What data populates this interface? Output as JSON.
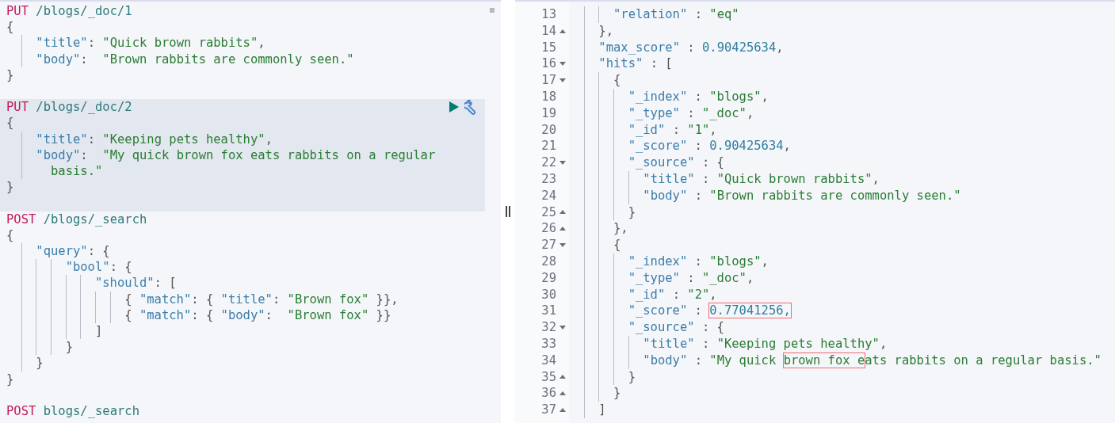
{
  "editor": {
    "requests": [
      {
        "method": "PUT",
        "path": "/blogs/_doc/1",
        "selected": false,
        "body": [
          {
            "tokens": [
              {
                "kind": "punct",
                "text": "{"
              }
            ],
            "children": [
              {
                "tokens": [
                  {
                    "kind": "key",
                    "text": "\"title\""
                  },
                  {
                    "kind": "punct",
                    "text": ": "
                  },
                  {
                    "kind": "string",
                    "text": "\"Quick brown rabbits\""
                  },
                  {
                    "kind": "punct",
                    "text": ","
                  }
                ]
              },
              {
                "tokens": [
                  {
                    "kind": "key",
                    "text": "\"body\""
                  },
                  {
                    "kind": "punct",
                    "text": ":  "
                  },
                  {
                    "kind": "string",
                    "text": "\"Brown rabbits are commonly seen.\""
                  }
                ]
              }
            ]
          },
          {
            "tokens": [
              {
                "kind": "punct",
                "text": "}"
              }
            ]
          }
        ]
      },
      {
        "method": "PUT",
        "path": "/blogs/_doc/2",
        "selected": true,
        "body": [
          {
            "tokens": [
              {
                "kind": "punct",
                "text": "{"
              }
            ],
            "children": [
              {
                "tokens": [
                  {
                    "kind": "key",
                    "text": "\"title\""
                  },
                  {
                    "kind": "punct",
                    "text": ": "
                  },
                  {
                    "kind": "string",
                    "text": "\"Keeping pets healthy\""
                  },
                  {
                    "kind": "punct",
                    "text": ","
                  }
                ]
              },
              {
                "tokens": [
                  {
                    "kind": "key",
                    "text": "\"body\""
                  },
                  {
                    "kind": "punct",
                    "text": ":  "
                  },
                  {
                    "kind": "string",
                    "text": "\"My quick brown fox eats rabbits on a regular basis.\""
                  }
                ]
              }
            ]
          },
          {
            "tokens": [
              {
                "kind": "punct",
                "text": "}"
              }
            ]
          }
        ]
      },
      {
        "method": "POST",
        "path": "/blogs/_search",
        "selected": false,
        "body": [
          {
            "tokens": [
              {
                "kind": "punct",
                "text": "{"
              }
            ],
            "children": [
              {
                "tokens": [
                  {
                    "kind": "key",
                    "text": "\"query\""
                  },
                  {
                    "kind": "punct",
                    "text": ": {"
                  }
                ],
                "children": [
                  {
                    "tokens": [
                      {
                        "kind": "key",
                        "text": "\"bool\""
                      },
                      {
                        "kind": "punct",
                        "text": ": {"
                      }
                    ],
                    "children": [
                      {
                        "tokens": [
                          {
                            "kind": "key",
                            "text": "\"should\""
                          },
                          {
                            "kind": "punct",
                            "text": ": ["
                          }
                        ],
                        "children": [
                          {
                            "tokens": [
                              {
                                "kind": "punct",
                                "text": "{ "
                              },
                              {
                                "kind": "key",
                                "text": "\"match\""
                              },
                              {
                                "kind": "punct",
                                "text": ": { "
                              },
                              {
                                "kind": "key",
                                "text": "\"title\""
                              },
                              {
                                "kind": "punct",
                                "text": ": "
                              },
                              {
                                "kind": "string",
                                "text": "\"Brown fox\""
                              },
                              {
                                "kind": "punct",
                                "text": " }},"
                              }
                            ]
                          },
                          {
                            "tokens": [
                              {
                                "kind": "punct",
                                "text": "{ "
                              },
                              {
                                "kind": "key",
                                "text": "\"match\""
                              },
                              {
                                "kind": "punct",
                                "text": ": { "
                              },
                              {
                                "kind": "key",
                                "text": "\"body\""
                              },
                              {
                                "kind": "punct",
                                "text": ":  "
                              },
                              {
                                "kind": "string",
                                "text": "\"Brown fox\""
                              },
                              {
                                "kind": "punct",
                                "text": " }}"
                              }
                            ]
                          }
                        ]
                      },
                      {
                        "tokens": [
                          {
                            "kind": "punct",
                            "text": "]"
                          }
                        ]
                      }
                    ]
                  },
                  {
                    "tokens": [
                      {
                        "kind": "punct",
                        "text": "}"
                      }
                    ]
                  }
                ]
              },
              {
                "tokens": [
                  {
                    "kind": "punct",
                    "text": "}"
                  }
                ]
              }
            ]
          },
          {
            "tokens": [
              {
                "kind": "punct",
                "text": "}"
              }
            ]
          }
        ]
      },
      {
        "method": "POST",
        "path": "blogs/_search",
        "selected": false
      }
    ]
  },
  "output": {
    "lines": [
      {
        "children": [
          {
            "children": [
              {
                "children": [
                  {
                    "number": "13",
                    "closes_block": false,
                    "tokens": [
                      {
                        "kind": "key",
                        "text": "\"relation\""
                      },
                      {
                        "kind": "punct",
                        "text": " : "
                      },
                      {
                        "kind": "string",
                        "text": "\"eq\""
                      }
                    ]
                  }
                ]
              },
              {
                "number": "14",
                "closes_block": true,
                "tokens": [
                  {
                    "kind": "punct",
                    "text": "},"
                  }
                ]
              },
              {
                "number": "15",
                "closes_block": false,
                "tokens": [
                  {
                    "kind": "key",
                    "text": "\"max_score\""
                  },
                  {
                    "kind": "punct",
                    "text": " : "
                  },
                  {
                    "kind": "number",
                    "text": "0.90425634"
                  },
                  {
                    "kind": "punct",
                    "text": ","
                  }
                ]
              },
              {
                "number": "16",
                "closes_block": false,
                "tokens": [
                  {
                    "kind": "key",
                    "text": "\"hits\""
                  },
                  {
                    "kind": "punct",
                    "text": " : ["
                  }
                ],
                "children": [
                  {
                    "number": "17",
                    "closes_block": false,
                    "tokens": [
                      {
                        "kind": "punct",
                        "text": "{"
                      }
                    ],
                    "children": [
                      {
                        "number": "18",
                        "closes_block": false,
                        "tokens": [
                          {
                            "kind": "key",
                            "text": "\"_index\""
                          },
                          {
                            "kind": "punct",
                            "text": " : "
                          },
                          {
                            "kind": "string",
                            "text": "\"blogs\""
                          },
                          {
                            "kind": "punct",
                            "text": ","
                          }
                        ]
                      },
                      {
                        "number": "19",
                        "closes_block": false,
                        "tokens": [
                          {
                            "kind": "key",
                            "text": "\"_type\""
                          },
                          {
                            "kind": "punct",
                            "text": " : "
                          },
                          {
                            "kind": "string",
                            "text": "\"_doc\""
                          },
                          {
                            "kind": "punct",
                            "text": ","
                          }
                        ]
                      },
                      {
                        "number": "20",
                        "closes_block": false,
                        "tokens": [
                          {
                            "kind": "key",
                            "text": "\"_id\""
                          },
                          {
                            "kind": "punct",
                            "text": " : "
                          },
                          {
                            "kind": "string",
                            "text": "\"1\""
                          },
                          {
                            "kind": "punct",
                            "text": ","
                          }
                        ]
                      },
                      {
                        "number": "21",
                        "closes_block": false,
                        "tokens": [
                          {
                            "kind": "key",
                            "text": "\"_score\""
                          },
                          {
                            "kind": "punct",
                            "text": " : "
                          },
                          {
                            "kind": "number",
                            "text": "0.90425634"
                          },
                          {
                            "kind": "punct",
                            "text": ","
                          }
                        ]
                      },
                      {
                        "number": "22",
                        "closes_block": false,
                        "tokens": [
                          {
                            "kind": "key",
                            "text": "\"_source\""
                          },
                          {
                            "kind": "punct",
                            "text": " : {"
                          }
                        ],
                        "children": [
                          {
                            "number": "23",
                            "closes_block": false,
                            "tokens": [
                              {
                                "kind": "key",
                                "text": "\"title\""
                              },
                              {
                                "kind": "punct",
                                "text": " : "
                              },
                              {
                                "kind": "string",
                                "text": "\"Quick brown rabbits\""
                              },
                              {
                                "kind": "punct",
                                "text": ","
                              }
                            ]
                          },
                          {
                            "number": "24",
                            "closes_block": false,
                            "tokens": [
                              {
                                "kind": "key",
                                "text": "\"body\""
                              },
                              {
                                "kind": "punct",
                                "text": " : "
                              },
                              {
                                "kind": "string",
                                "text": "\"Brown rabbits are commonly seen.\""
                              }
                            ]
                          }
                        ]
                      },
                      {
                        "number": "25",
                        "closes_block": true,
                        "tokens": [
                          {
                            "kind": "punct",
                            "text": "}"
                          }
                        ]
                      }
                    ]
                  },
                  {
                    "number": "26",
                    "closes_block": true,
                    "tokens": [
                      {
                        "kind": "punct",
                        "text": "},"
                      }
                    ]
                  },
                  {
                    "number": "27",
                    "closes_block": false,
                    "tokens": [
                      {
                        "kind": "punct",
                        "text": "{"
                      }
                    ],
                    "children": [
                      {
                        "number": "28",
                        "closes_block": false,
                        "tokens": [
                          {
                            "kind": "key",
                            "text": "\"_index\""
                          },
                          {
                            "kind": "punct",
                            "text": " : "
                          },
                          {
                            "kind": "string",
                            "text": "\"blogs\""
                          },
                          {
                            "kind": "punct",
                            "text": ","
                          }
                        ]
                      },
                      {
                        "number": "29",
                        "closes_block": false,
                        "tokens": [
                          {
                            "kind": "key",
                            "text": "\"_type\""
                          },
                          {
                            "kind": "punct",
                            "text": " : "
                          },
                          {
                            "kind": "string",
                            "text": "\"_doc\""
                          },
                          {
                            "kind": "punct",
                            "text": ","
                          }
                        ]
                      },
                      {
                        "number": "30",
                        "closes_block": false,
                        "tokens": [
                          {
                            "kind": "key",
                            "text": "\"_id\""
                          },
                          {
                            "kind": "punct",
                            "text": " : "
                          },
                          {
                            "kind": "string",
                            "text": "\"2\""
                          },
                          {
                            "kind": "punct",
                            "text": ","
                          }
                        ]
                      },
                      {
                        "number": "31",
                        "closes_block": false,
                        "tokens": [
                          {
                            "kind": "key",
                            "text": "\"_score\""
                          },
                          {
                            "kind": "punct",
                            "text": " : "
                          },
                          {
                            "kind": "number",
                            "text": "0.77041256,",
                            "boxed": true
                          }
                        ]
                      },
                      {
                        "number": "32",
                        "closes_block": false,
                        "tokens": [
                          {
                            "kind": "key",
                            "text": "\"_source\""
                          },
                          {
                            "kind": "punct",
                            "text": " : {"
                          }
                        ],
                        "children": [
                          {
                            "number": "33",
                            "closes_block": false,
                            "tokens": [
                              {
                                "kind": "key",
                                "text": "\"title\""
                              },
                              {
                                "kind": "punct",
                                "text": " : "
                              },
                              {
                                "kind": "string",
                                "text": "\"Keeping pets healthy\""
                              },
                              {
                                "kind": "punct",
                                "text": ","
                              }
                            ]
                          },
                          {
                            "number": "34",
                            "closes_block": false,
                            "tokens": [
                              {
                                "kind": "key",
                                "text": "\"body\""
                              },
                              {
                                "kind": "punct",
                                "text": " : "
                              },
                              {
                                "kind": "string",
                                "text": "\"My quick "
                              },
                              {
                                "kind": "string",
                                "text": "brown fox e",
                                "boxed": true
                              },
                              {
                                "kind": "string",
                                "text": "ats rabbits on a regular basis.\""
                              }
                            ]
                          }
                        ]
                      },
                      {
                        "number": "35",
                        "closes_block": true,
                        "tokens": [
                          {
                            "kind": "punct",
                            "text": "}"
                          }
                        ]
                      }
                    ]
                  },
                  {
                    "number": "36",
                    "closes_block": true,
                    "tokens": [
                      {
                        "kind": "punct",
                        "text": "}"
                      }
                    ]
                  }
                ]
              },
              {
                "number": "37",
                "closes_block": true,
                "tokens": [
                  {
                    "kind": "punct",
                    "text": "]"
                  }
                ]
              }
            ]
          }
        ]
      }
    ]
  }
}
